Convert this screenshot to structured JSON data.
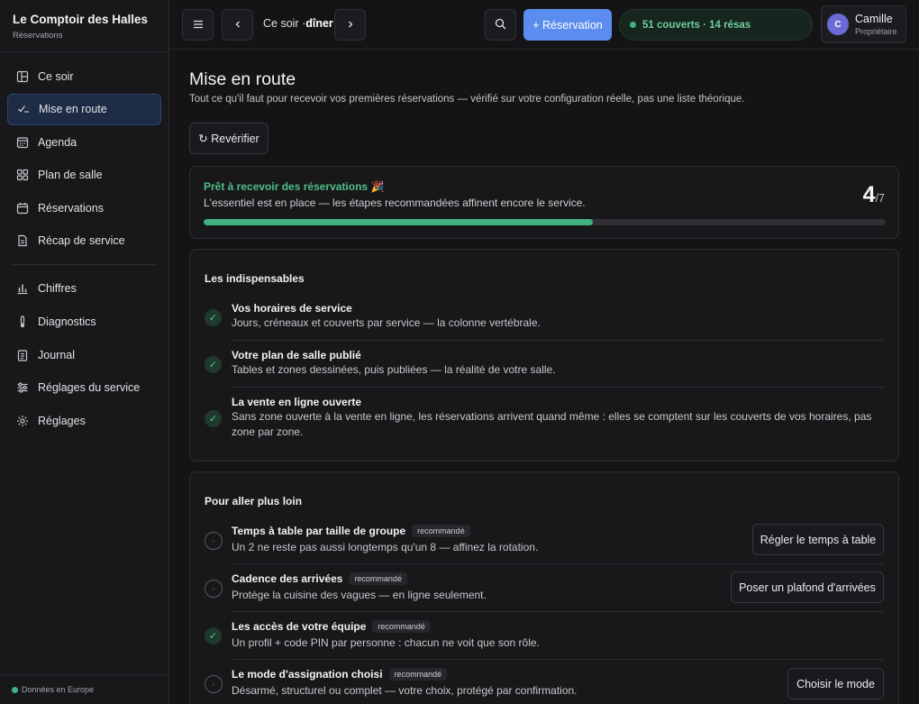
{
  "sidebar": {
    "brand_title": "Le Comptoir des Halles",
    "brand_sub": "Réservations",
    "items": [
      {
        "label": "Ce soir",
        "icon": "columns-icon"
      },
      {
        "label": "Mise en route",
        "icon": "check-list-icon"
      },
      {
        "label": "Agenda",
        "icon": "calendar-grid-icon"
      },
      {
        "label": "Plan de salle",
        "icon": "grid-icon"
      },
      {
        "label": "Réservations",
        "icon": "calendar-icon"
      },
      {
        "label": "Récap de service",
        "icon": "document-icon"
      },
      {
        "label": "Chiffres",
        "icon": "bar-chart-icon"
      },
      {
        "label": "Diagnostics",
        "icon": "thermometer-icon"
      },
      {
        "label": "Journal",
        "icon": "clipboard-icon"
      },
      {
        "label": "Réglages du service",
        "icon": "sliders-icon"
      },
      {
        "label": "Réglages",
        "icon": "gear-icon"
      }
    ],
    "footer": "Données en Europe"
  },
  "topbar": {
    "title_prefix": "Ce soir ·",
    "title_service": "dîner",
    "reservation_button": "+ Réservation",
    "status": "51 couverts · 14 résas",
    "user_initial": "C",
    "user_name": "Camille",
    "user_role": "Propriétaire"
  },
  "main": {
    "title": "Mise en route",
    "subtitle": "Tout ce qu'il faut pour recevoir vos premières réservations — vérifié sur votre configuration réelle, pas une liste théorique.",
    "recheck_label": "↻ Revérifier",
    "progress": {
      "title": "Prêt à recevoir des réservations 🎉",
      "subtitle": "L'essentiel est en place — les étapes recommandées affinent encore le service.",
      "done": "4",
      "total": "/7",
      "fraction": 0.571
    },
    "essentials": {
      "title": "Les indispensables",
      "items": [
        {
          "title": "Vos horaires de service",
          "desc": "Jours, créneaux et couverts par service — la colonne vertébrale."
        },
        {
          "title": "Votre plan de salle publié",
          "desc": "Tables et zones dessinées, puis publiées — la réalité de votre salle."
        },
        {
          "title": "La vente en ligne ouverte",
          "desc": "Sans zone ouverte à la vente en ligne, les réservations arrivent quand même : elles se comptent sur les couverts de vos horaires, pas zone par zone."
        }
      ]
    },
    "further": {
      "title": "Pour aller plus loin",
      "tag": "recommandé",
      "items": [
        {
          "title": "Temps à table par taille de groupe",
          "desc": "Un 2 ne reste pas aussi longtemps qu'un 8 — affinez la rotation.",
          "action": "Régler le temps à table",
          "done": false
        },
        {
          "title": "Cadence des arrivées",
          "desc": "Protège la cuisine des vagues — en ligne seulement.",
          "action": "Poser un plafond d'arrivées",
          "done": false
        },
        {
          "title": "Les accès de votre équipe",
          "desc": "Un profil + code PIN par personne : chacun ne voit que son rôle.",
          "action": "",
          "done": true
        },
        {
          "title": "Le mode d'assignation choisi",
          "desc": "Désarmé, structurel ou complet — votre choix, protégé par confirmation.",
          "action": "Choisir le mode",
          "done": false
        }
      ]
    }
  }
}
